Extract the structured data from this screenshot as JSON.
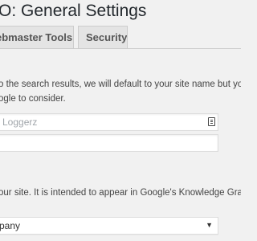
{
  "header": {
    "title": "O: General Settings"
  },
  "tabs": [
    {
      "label": "ebmaster Tools"
    },
    {
      "label": "Security"
    }
  ],
  "site_name_section": {
    "description_line1": "o the search results, we will default to your site name but you can a",
    "description_line2": "ogle to consider.",
    "site_name_field": {
      "value": "Loggerz",
      "icon": "contact-card-icon"
    },
    "alt_name_field": {
      "value": ""
    }
  },
  "knowledge_graph_section": {
    "description": "our site. It is intended to appear in Google's Knowledge Graph. You",
    "type_select": {
      "selected": "pany",
      "arrow_icon": "dropdown-arrow-icon"
    }
  }
}
